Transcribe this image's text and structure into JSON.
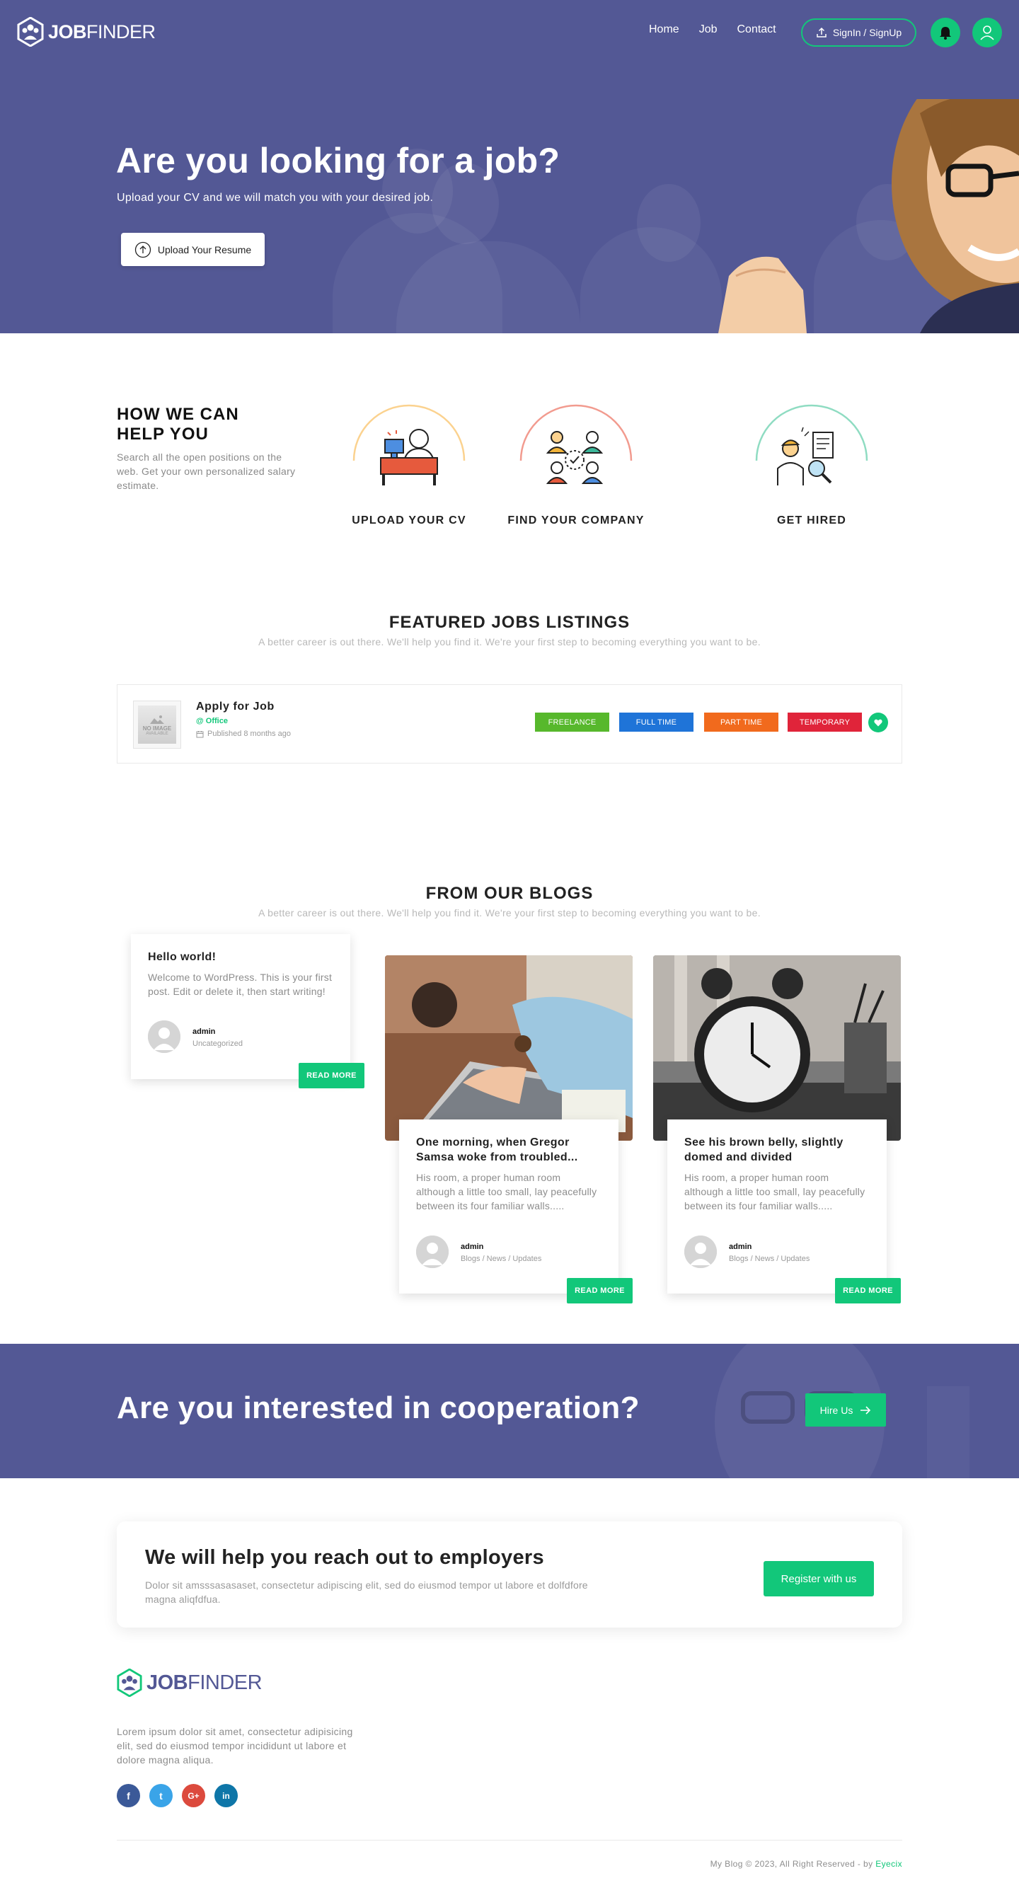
{
  "brand": {
    "name_bold": "JOB",
    "name_light": "FINDER"
  },
  "nav": {
    "links": [
      "Home",
      "Job",
      "Contact"
    ],
    "signin_label": "SignIn / SignUp"
  },
  "hero": {
    "title": "Are you looking for a job?",
    "subtitle": "Upload your CV and we will match you with your desired job.",
    "upload_label": "Upload Your Resume"
  },
  "how": {
    "title": "HOW WE CAN HELP YOU",
    "text": "Search all the open positions on the web. Get your own personalized salary estimate.",
    "steps": [
      {
        "label": "UPLOAD YOUR CV",
        "icon": "upload-cv-icon",
        "arc_color": "#fbd28f"
      },
      {
        "label": "FIND YOUR COMPANY",
        "icon": "find-company-icon",
        "arc_color": "#f29b8f"
      },
      {
        "label": "GET HIRED",
        "icon": "get-hired-icon",
        "arc_color": "#8fdcc2"
      }
    ]
  },
  "featured": {
    "title": "FEATURED JOBS LISTINGS",
    "subtitle": "A better career is out there. We'll help you find it. We're your first step to becoming everything you want to be.",
    "job": {
      "thumb_label": "NO IMAGE",
      "thumb_sublabel": "AVAILABLE",
      "title": "Apply for Job",
      "location": "@ Office",
      "published": "Published 8 months ago",
      "badges": [
        {
          "label": "FREELANCE",
          "color": "#57b82c"
        },
        {
          "label": "FULL TIME",
          "color": "#1f74d8"
        },
        {
          "label": "PART TIME",
          "color": "#f16a1d"
        },
        {
          "label": "TEMPORARY",
          "color": "#e0243a"
        }
      ]
    }
  },
  "blogs": {
    "title": "FROM OUR BLOGS",
    "subtitle": "A better career is out there. We'll help you find it. We're your first step to becoming everything you want to be.",
    "read_more_label": "READ MORE",
    "posts": [
      {
        "title": "Hello world!",
        "excerpt": "Welcome to WordPress. This is your first post. Edit or delete it, then start writing!",
        "author": "admin",
        "category": "Uncategorized"
      },
      {
        "title": "One morning, when Gregor Samsa woke from troubled...",
        "excerpt": "His room, a proper human room although a little too small, lay peacefully between its four familiar walls.....",
        "author": "admin",
        "category": "Blogs / News / Updates"
      },
      {
        "title": "See his brown belly, slightly domed and divided",
        "excerpt": "His room, a proper human room although a little too small, lay peacefully between its four familiar walls.....",
        "author": "admin",
        "category": "Blogs / News / Updates"
      }
    ]
  },
  "cooperation": {
    "title": "Are you interested in cooperation?",
    "button_label": "Hire Us"
  },
  "employers": {
    "title": "We will help you reach out to employers",
    "text": "Dolor sit amsssasasaset, consectetur adipiscing elit, sed do eiusmod tempor ut labore et dolfdfore magna aliqfdfua.",
    "button_label": "Register with us"
  },
  "footer": {
    "text": "Lorem ipsum dolor sit amet, consectetur adipisicing elit, sed do eiusmod tempor incididunt ut labore et dolore magna aliqua.",
    "social": [
      {
        "name": "facebook",
        "glyph": "f",
        "color": "#3b5998"
      },
      {
        "name": "twitter",
        "glyph": "t",
        "color": "#3aa4e8"
      },
      {
        "name": "google-plus",
        "glyph": "G+",
        "color": "#dc4a3d"
      },
      {
        "name": "linkedin",
        "glyph": "in",
        "color": "#0e76a8"
      }
    ],
    "copyright_prefix": "My Blog © 2023, All Right Reserved - by",
    "copyright_brand": "Eyecix"
  },
  "colors": {
    "primary": "#535895",
    "accent": "#12c77a"
  }
}
